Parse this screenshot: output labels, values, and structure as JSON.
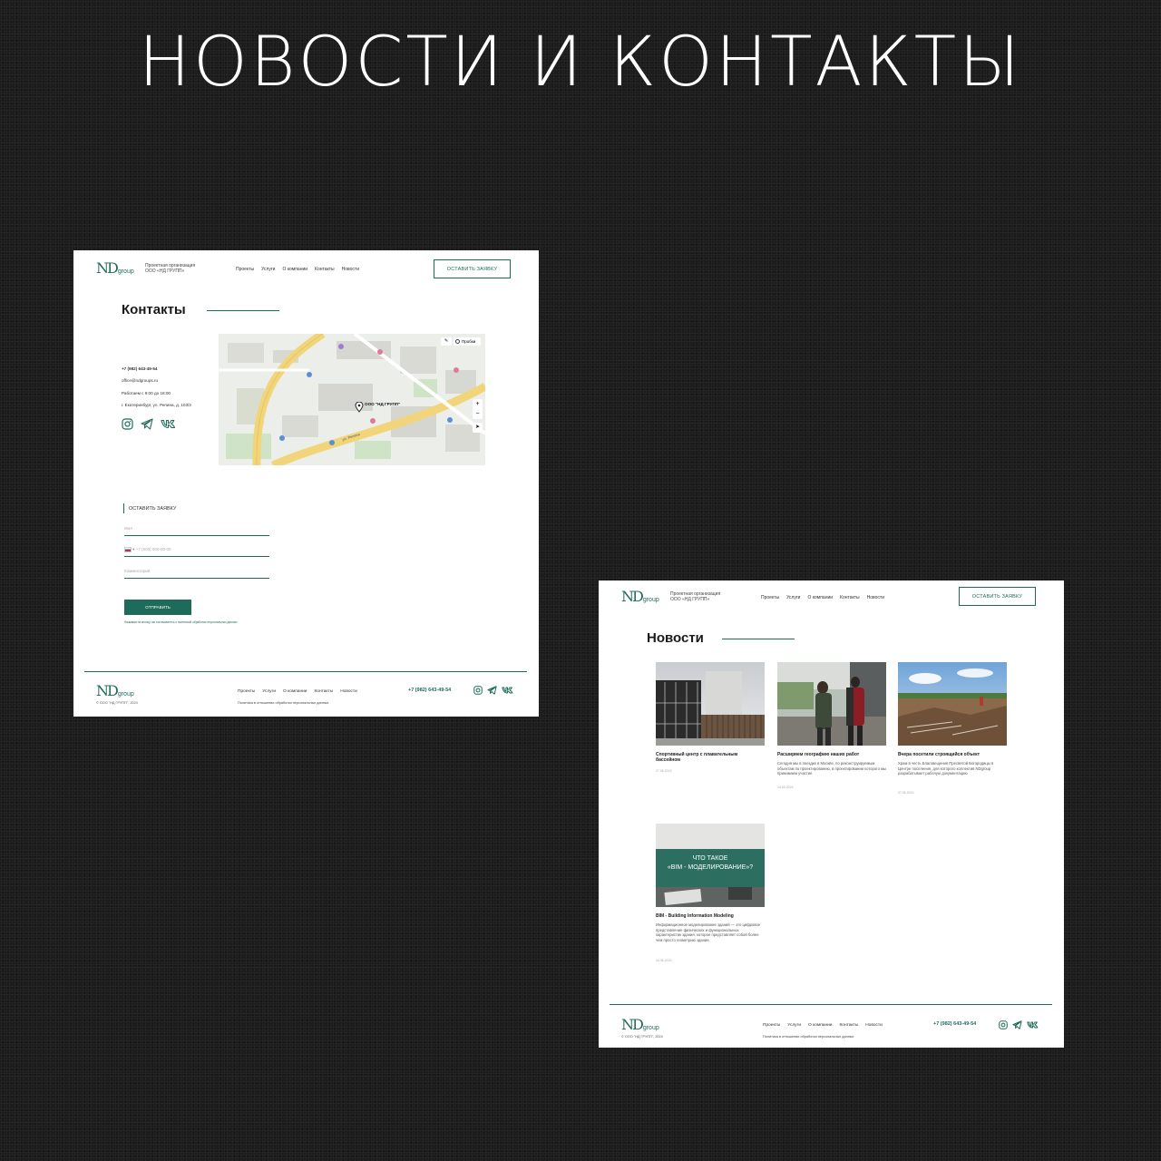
{
  "hero_title": "НОВОСТИ И КОНТАКТЫ",
  "site": {
    "logo_mark": "ND",
    "logo_suffix": "group",
    "company_line1": "Проектная организация",
    "company_line2": "ООО «НД ГРУПП»",
    "nav": [
      "Проекты",
      "Услуги",
      "О компании",
      "Контакты",
      "Новости"
    ],
    "cta": "ОСТАВИТЬ ЗАЯВКУ",
    "accent_color": "#1f6b5a"
  },
  "contacts_page": {
    "title": "Контакты",
    "phone": "+7 (982) 643-49-54",
    "email": "office@ndgroups.ru",
    "hours": "Работаем с 9:00 до 18:00",
    "address": "г. Екатеринбург, ул. Репина, д. 103/3",
    "social_icons": [
      "instagram-icon",
      "telegram-icon",
      "vk-icon"
    ],
    "map": {
      "pin_label": "ООО \"НД ГРУПП\"",
      "traffic_label": "Пробки",
      "street_label": "ул. Репина"
    },
    "form": {
      "title": "ОСТАВИТЬ ЗАЯВКУ",
      "name_placeholder": "Имя",
      "phone_placeholder": "+7 (000) 000-00-00",
      "comment_placeholder": "Комментарий",
      "submit": "ОТПРАВИТЬ",
      "consent": "Нажимая на кнопку, вы соглашаетесь с политикой обработки персональных данных"
    }
  },
  "news_page": {
    "title": "Новости",
    "items": [
      {
        "title": "Спортивный центр с плавательным бассейном",
        "text": "",
        "date": "27.06.2024"
      },
      {
        "title": "Расширяем географию наших работ",
        "text": "Сегодня мы в поездке в Москве, по реконструируемым объектам по проектированию, в проектировании которого мы принимаем участие",
        "date": "14.06.2024"
      },
      {
        "title": "Вчера посетили строящийся объект",
        "text": "Храм в честь Благовещения Пресвятой Богородицы в Центре поселения, для которого коллектив NDgroup разрабатывает рабочую документацию",
        "date": "07.06.2024"
      },
      {
        "title": "BIM - Building Information Modeling",
        "text": "Информационное моделирование зданий — это цифровое представление физических и функциональных характеристик здания, которое представляет собой более чем просто геометрию здания.",
        "date": "04.06.2024",
        "overlay_line1": "ЧТО ТАКОЕ",
        "overlay_line2": "«BIM - МОДЕЛИРОВАНИЕ»?"
      }
    ]
  },
  "footer": {
    "copyright": "© ООО \"НД ГРУПП\", 2024",
    "nav": [
      "Проекты",
      "Услуги",
      "О компании",
      "Контакты",
      "Новости"
    ],
    "policy": "Политика в отношении обработки персональных данных",
    "phone": "+7 (982) 643-49-54"
  }
}
